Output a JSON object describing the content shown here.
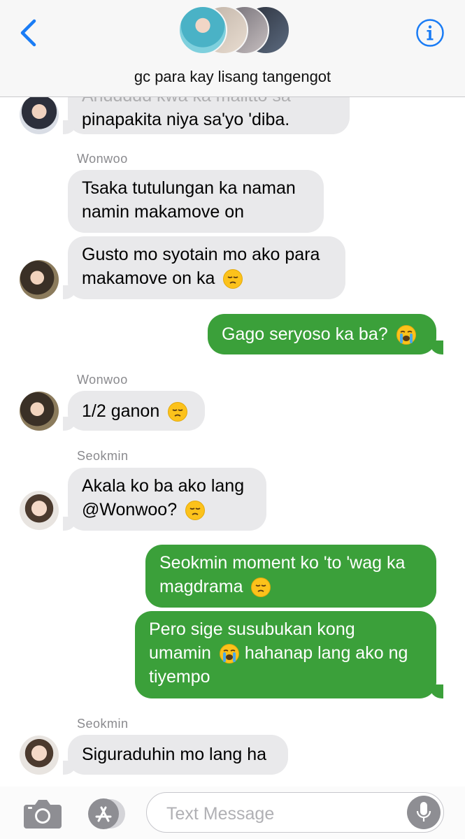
{
  "header": {
    "title": "gc para kay lisang tangengot",
    "back_icon": "chevron-left-icon",
    "info_icon": "info-icon"
  },
  "messages": [
    {
      "type": "in",
      "text_lines": [
        "Anddddd kwa ka malitto sa",
        "pinapakita niya sa'yo 'diba."
      ]
    },
    {
      "type": "in",
      "sender": "Wonwoo",
      "text_lines": [
        "Tsaka tutulungan ka naman",
        "namin makamove on"
      ]
    },
    {
      "type": "in",
      "text_lines": [
        "Gusto mo syotain mo ako para",
        "makamove on ka"
      ]
    },
    {
      "type": "out",
      "text": "Gago seryoso ka ba?"
    },
    {
      "type": "in",
      "sender": "Wonwoo",
      "text": "1/2 ganon"
    },
    {
      "type": "in",
      "sender": "Seokmin",
      "text_lines": [
        "Akala ko ba ako lang",
        "@Wonwoo?"
      ]
    },
    {
      "type": "out",
      "text_lines": [
        "Seokmin moment ko 'to 'wag ka",
        "magdrama"
      ]
    },
    {
      "type": "out",
      "text_lines": [
        "Pero sige susubukan kong",
        "umamin",
        "hahanap lang ako ng",
        "tiyempo"
      ]
    },
    {
      "type": "in",
      "sender": "Seokmin",
      "text": "Siguraduhin mo lang ha"
    }
  ],
  "composer": {
    "placeholder": "Text Message",
    "camera_icon": "camera-icon",
    "appstore_icon": "app-store-icon",
    "mic_icon": "microphone-icon"
  },
  "colors": {
    "incoming": "#e9e9eb",
    "outgoing": "#3ba03a",
    "accent": "#1a7cf5"
  }
}
